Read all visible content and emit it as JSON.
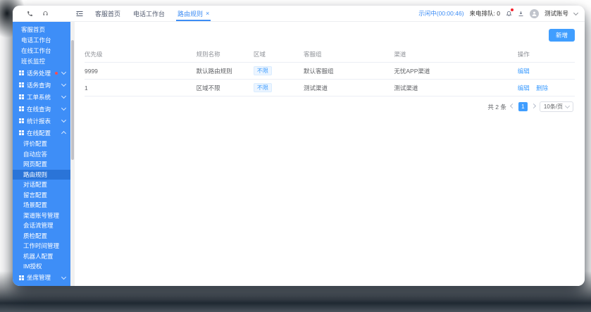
{
  "topbar": {
    "tabs": [
      {
        "label": "客服首页"
      },
      {
        "label": "电话工作台"
      },
      {
        "label": "路由规则",
        "close_glyph": "×"
      }
    ],
    "status": {
      "call_state": "示闲中(00:00:46)",
      "queue_label": "来电排队: 0"
    },
    "user": {
      "name": "测试账号"
    }
  },
  "sidebar": {
    "top_items": [
      "客服首页",
      "电话工作台",
      "在线工作台",
      "班长监控"
    ],
    "groups": [
      {
        "label": "话务处理"
      },
      {
        "label": "话务查询"
      },
      {
        "label": "工单系统"
      },
      {
        "label": "在线查询"
      },
      {
        "label": "统计报表"
      },
      {
        "label": "在线配置"
      },
      {
        "label": "坐席管理"
      }
    ],
    "online_config_children": [
      "评价配置",
      "自动应答",
      "网页配置",
      "路由规则",
      "对话配置",
      "留言配置",
      "场景配置",
      "渠道账号管理",
      "会话流管理",
      "质检配置",
      "工作时间管理",
      "机器人配置",
      "IM授权"
    ],
    "active_child": "路由规则"
  },
  "main": {
    "add_button": "新增",
    "table": {
      "columns": [
        "优先级",
        "规则名称",
        "区域",
        "客服组",
        "渠道",
        "操作"
      ],
      "rows": [
        {
          "priority": "9999",
          "name": "默认路由规则",
          "region_tag": "不限",
          "group": "默认客服组",
          "channel": "无忧APP渠道",
          "actions": [
            "编辑"
          ]
        },
        {
          "priority": "1",
          "name": "区域不限",
          "region_tag": "不限",
          "group": "测试渠道",
          "channel": "测试渠道",
          "actions": [
            "编辑",
            "删除"
          ]
        }
      ]
    },
    "pagination": {
      "total": "共 2 条",
      "page": "1",
      "page_size": "10条/页"
    }
  },
  "colors": {
    "sidebar": "#3e8ef7",
    "sidebar_active": "#2a74d8",
    "accent": "#409eff",
    "danger": "#f5222d"
  }
}
